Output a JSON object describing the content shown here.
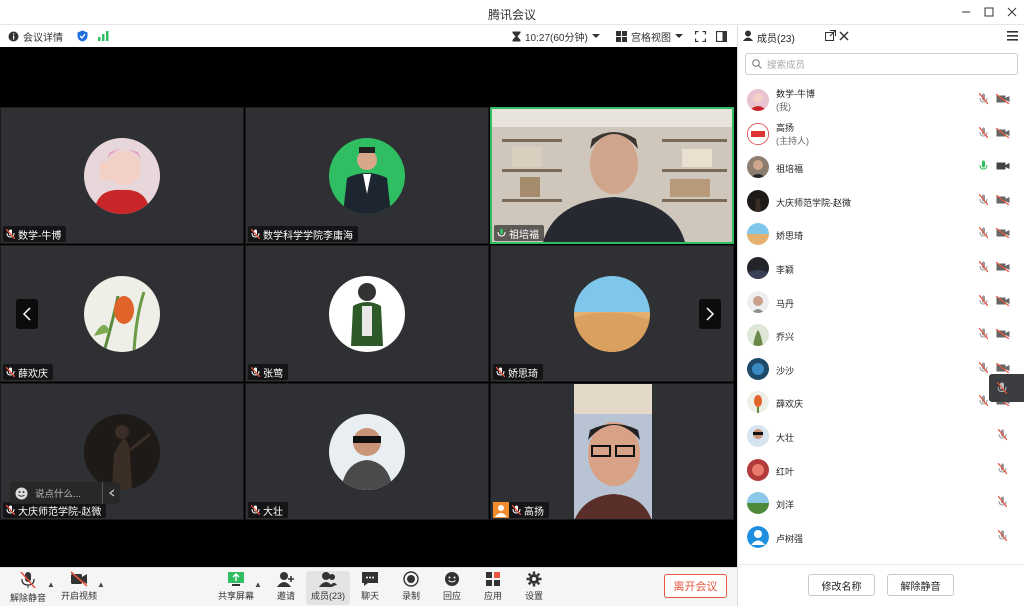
{
  "window": {
    "title": "腾讯会议"
  },
  "toolbar": {
    "meeting_detail": "会议详情",
    "timer": "10:27(60分钟)",
    "view_mode": "宫格视图"
  },
  "tiles": [
    {
      "name": "数学-牛博",
      "mic": "muted"
    },
    {
      "name": "数学科学学院李庸海",
      "mic": "muted"
    },
    {
      "name": "祖培福",
      "mic": "active"
    },
    {
      "name": "薛欢庆",
      "mic": "muted"
    },
    {
      "name": "张莺",
      "mic": "muted"
    },
    {
      "name": "娇思琦",
      "mic": "muted"
    },
    {
      "name": "大庆师范学院-赵微",
      "mic": "muted"
    },
    {
      "name": "大壮",
      "mic": "muted"
    },
    {
      "name": "高扬",
      "mic": "muted"
    }
  ],
  "chat": {
    "placeholder": "说点什么..."
  },
  "bottom_bar": {
    "unmute": "解除静音",
    "start_video": "开启视频",
    "share_screen": "共享屏幕",
    "invite": "邀请",
    "members": "成员(23)",
    "chat": "聊天",
    "record": "录制",
    "replay": "回应",
    "apps": "应用",
    "settings": "设置",
    "leave": "离开会议"
  },
  "panel": {
    "title": "成员(23)",
    "search_placeholder": "搜索成员",
    "members": [
      {
        "name": "数学-牛博",
        "role": "(我)",
        "mic": "muted",
        "cam": "off"
      },
      {
        "name": "高扬",
        "role": "(主持人)",
        "mic": "muted",
        "cam": "off"
      },
      {
        "name": "祖培福",
        "role": "",
        "mic": "active",
        "cam": "on"
      },
      {
        "name": "大庆师范学院-赵微",
        "role": "",
        "mic": "muted",
        "cam": "off"
      },
      {
        "name": "娇思琦",
        "role": "",
        "mic": "muted",
        "cam": "off"
      },
      {
        "name": "李颖",
        "role": "",
        "mic": "muted",
        "cam": "off"
      },
      {
        "name": "马丹",
        "role": "",
        "mic": "muted",
        "cam": "off"
      },
      {
        "name": "乔兴",
        "role": "",
        "mic": "muted",
        "cam": "off"
      },
      {
        "name": "沙沙",
        "role": "",
        "mic": "muted",
        "cam": "off"
      },
      {
        "name": "薛欢庆",
        "role": "",
        "mic": "muted",
        "cam": "off"
      },
      {
        "name": "大壮",
        "role": "",
        "mic": "muted",
        "cam": "none"
      },
      {
        "name": "红叶",
        "role": "",
        "mic": "muted",
        "cam": "none"
      },
      {
        "name": "刘洋",
        "role": "",
        "mic": "muted",
        "cam": "none"
      },
      {
        "name": "卢树强",
        "role": "",
        "mic": "muted",
        "cam": "none"
      }
    ],
    "rename": "修改名称",
    "unmute": "解除静音"
  },
  "colors": {
    "active_green": "#2fbe62",
    "muted_red": "#e8553f",
    "accent_blue": "#1e6fe0"
  }
}
